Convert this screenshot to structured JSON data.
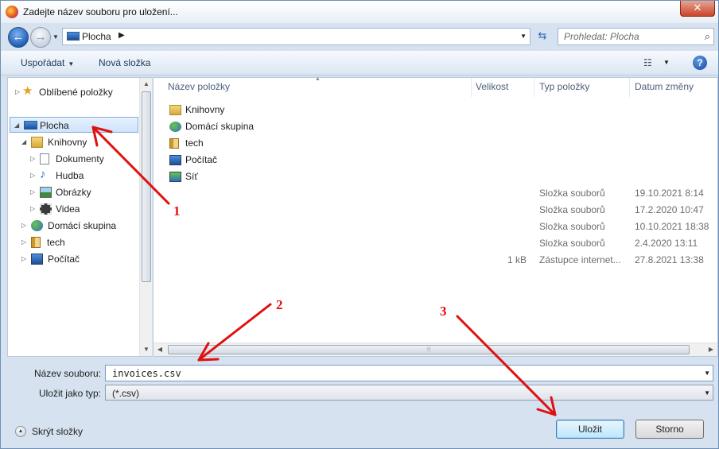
{
  "window": {
    "title": "Zadejte název souboru pro uložení..."
  },
  "address": {
    "location": "Plocha",
    "search_placeholder": "Prohledat: Plocha"
  },
  "toolbar": {
    "organize": "Uspořádat",
    "new_folder": "Nová složka"
  },
  "navigation": {
    "favorites": "Oblíbené položky",
    "desktop": "Plocha",
    "libraries": "Knihovny",
    "documents": "Dokumenty",
    "music": "Hudba",
    "pictures": "Obrázky",
    "videos": "Videa",
    "homegroup": "Domácí skupina",
    "tech": "tech",
    "computer": "Počítač"
  },
  "columns": {
    "name": "Název položky",
    "size": "Velikost",
    "type": "Typ položky",
    "date": "Datum změny"
  },
  "files": [
    {
      "name": "Knihovny",
      "size": "",
      "type": "",
      "date": "",
      "icon": "library-icon"
    },
    {
      "name": "Domácí skupina",
      "size": "",
      "type": "",
      "date": "",
      "icon": "homegroup-icon"
    },
    {
      "name": "tech",
      "size": "",
      "type": "",
      "date": "",
      "icon": "user-folder-icon"
    },
    {
      "name": "Počítač",
      "size": "",
      "type": "",
      "date": "",
      "icon": "computer-icon"
    },
    {
      "name": "Síť",
      "size": "",
      "type": "",
      "date": "",
      "icon": "network-icon"
    },
    {
      "name": "",
      "size": "",
      "type": "Složka souborů",
      "date": "19.10.2021 8:14",
      "icon": ""
    },
    {
      "name": "",
      "size": "",
      "type": "Složka souborů",
      "date": "17.2.2020 10:47",
      "icon": ""
    },
    {
      "name": "",
      "size": "",
      "type": "Složka souborů",
      "date": "10.10.2021 18:38",
      "icon": ""
    },
    {
      "name": "",
      "size": "",
      "type": "Složka souborů",
      "date": "2.4.2020 13:11",
      "icon": ""
    },
    {
      "name": "",
      "size": "1 kB",
      "type": "Zástupce internet...",
      "date": "27.8.2021 13:38",
      "icon": ""
    }
  ],
  "form": {
    "filename_label": "Název souboru:",
    "filename_value": "invoices.csv",
    "filetype_label": "Uložit jako typ:",
    "filetype_value": "(*.csv)"
  },
  "footer": {
    "hide_folders": "Skrýt složky",
    "save": "Uložit",
    "cancel": "Storno"
  },
  "annotations": {
    "one": "1",
    "two": "2",
    "three": "3",
    "color": "#e01010"
  }
}
